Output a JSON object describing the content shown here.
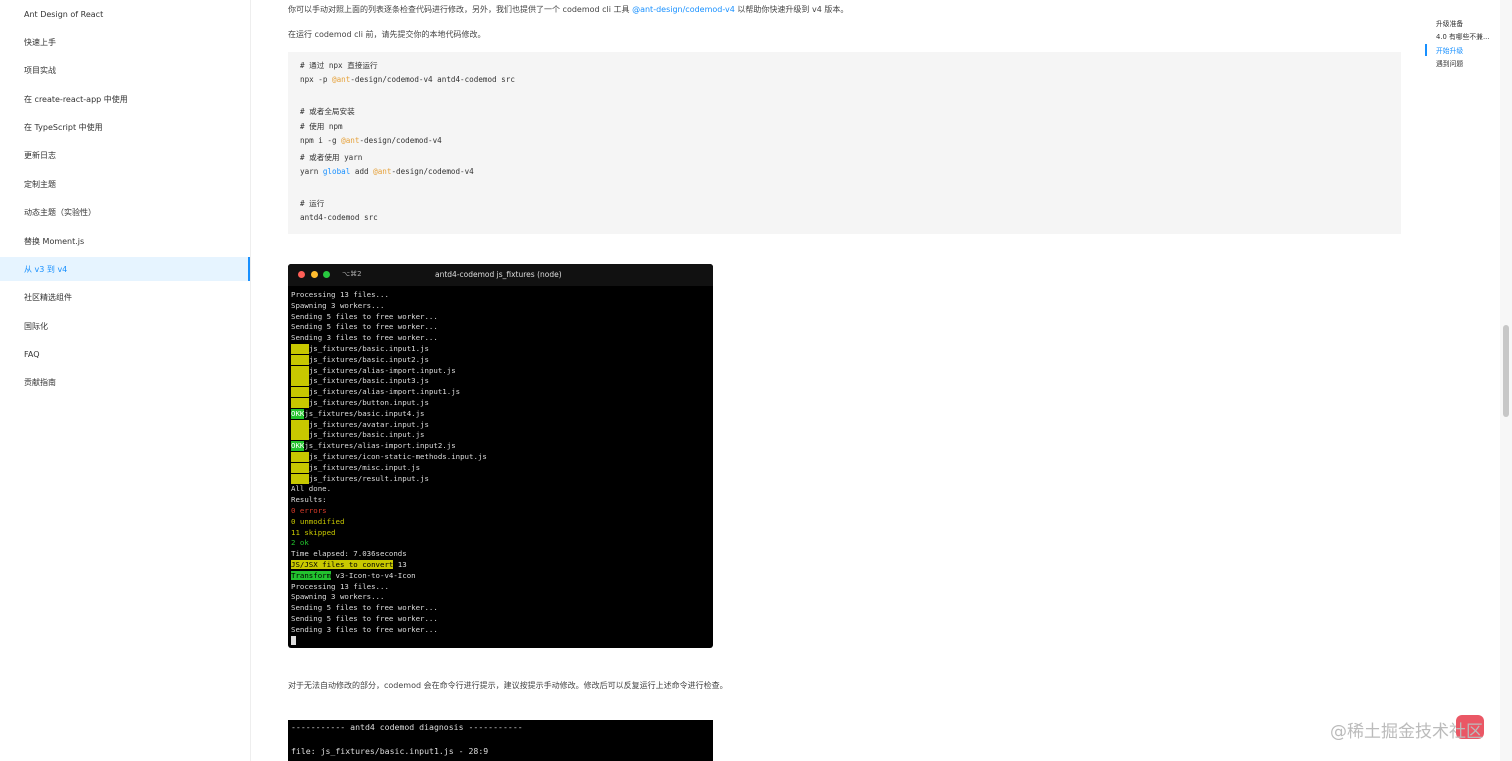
{
  "sidebar": {
    "items": [
      {
        "label": "Ant Design of React"
      },
      {
        "label": "快速上手"
      },
      {
        "label": "项目实战"
      },
      {
        "label": "在 create-react-app 中使用"
      },
      {
        "label": "在 TypeScript 中使用"
      },
      {
        "label": "更新日志"
      },
      {
        "label": "定制主题"
      },
      {
        "label": "动态主题（实验性）"
      },
      {
        "label": "替换 Moment.js"
      },
      {
        "label": "从 v3 到 v4"
      },
      {
        "label": "社区精选组件"
      },
      {
        "label": "国际化"
      },
      {
        "label": "FAQ"
      },
      {
        "label": "贡献指南"
      }
    ],
    "active_index": 9
  },
  "main": {
    "para1_before": "你可以手动对照上面的列表逐条检查代码进行修改，另外，我们也提供了一个 codemod cli 工具 ",
    "para1_link": "@ant-design/codemod-v4",
    "para1_after": " 以帮助你快速升级到 v4 版本。",
    "para2": "在运行 codemod cli 前，请先提交你的本地代码修改。",
    "code": {
      "l1": "# 通过 npx 直接运行",
      "l2_a": "npx -p ",
      "l2_at": "@ant",
      "l2_b": "-design/codemod-v4 antd4-codemod src",
      "l3": "# 或者全局安装",
      "l4": "# 使用 npm",
      "l5_a": "npm i -g ",
      "l5_at": "@ant",
      "l5_b": "-design/codemod-v4",
      "l6": "# 或者使用 yarn",
      "l7_a": "yarn ",
      "l7_kw": "global",
      "l7_b": " add ",
      "l7_at": "@ant",
      "l7_c": "-design/codemod-v4",
      "l8": "# 运行",
      "l9": "antd4-codemod src"
    },
    "para3": "对于无法自动修改的部分，codemod 会在命令行进行提示，建议按提示手动修改。修改后可以反复运行上述命令进行检查。"
  },
  "terminal": {
    "shortcut": "⌥⌘2",
    "title": "antd4-codemod js_fixtures (node)",
    "lines_top": [
      "Processing 13 files...",
      "Spawning 3 workers...",
      "Sending 5 files to free worker...",
      "Sending 5 files to free worker...",
      "Sending 3 files to free worker..."
    ],
    "file_results": [
      {
        "status": "skip",
        "badge": "SKIP",
        "file": "js_fixtures/basic.input1.js"
      },
      {
        "status": "skip",
        "badge": "SKIP",
        "file": "js_fixtures/basic.input2.js"
      },
      {
        "status": "skip",
        "badge": "SKIP",
        "file": "js_fixtures/alias-import.input.js"
      },
      {
        "status": "skip",
        "badge": "SKIP",
        "file": "js_fixtures/basic.input3.js"
      },
      {
        "status": "skip",
        "badge": "SKIP",
        "file": "js_fixtures/alias-import.input1.js"
      },
      {
        "status": "skip",
        "badge": "SKIP",
        "file": "js_fixtures/button.input.js"
      },
      {
        "status": "ok",
        "badge": "OKK",
        "file": "js_fixtures/basic.input4.js"
      },
      {
        "status": "skip",
        "badge": "SKIP",
        "file": "js_fixtures/avatar.input.js"
      },
      {
        "status": "skip",
        "badge": "SKIP",
        "file": "js_fixtures/basic.input.js"
      },
      {
        "status": "ok",
        "badge": "OKK",
        "file": "js_fixtures/alias-import.input2.js"
      },
      {
        "status": "skip",
        "badge": "SKIP",
        "file": "js_fixtures/icon-static-methods.input.js"
      },
      {
        "status": "skip",
        "badge": "SKIP",
        "file": "js_fixtures/misc.input.js"
      },
      {
        "status": "skip",
        "badge": "SKIP",
        "file": "js_fixtures/result.input.js"
      }
    ],
    "all_done": "All done.",
    "results": "Results:",
    "errors": "0 errors",
    "unmodified": "0 unmodified",
    "skipped": "11 skipped",
    "ok": "2 ok",
    "elapsed": "Time elapsed: 7.036seconds",
    "convert_label": "JS/JSX files to convert",
    "convert_count": " 13",
    "transform_label": "Transform",
    "transform_value": " v3-Icon-to-v4-Icon",
    "lines_bottom": [
      "Processing 13 files...",
      "Spawning 3 workers...",
      "Sending 5 files to free worker...",
      "Sending 5 files to free worker...",
      "Sending 3 files to free worker..."
    ]
  },
  "terminal2": {
    "l1": "----------- antd4 codemod diagnosis -----------",
    "l2": "file: js_fixtures/basic.input1.js - 28:9"
  },
  "toc": {
    "items": [
      {
        "label": "升级准备"
      },
      {
        "label": "4.0 有哪些不兼..."
      },
      {
        "label": "开始升级"
      },
      {
        "label": "遇到问题"
      }
    ],
    "active_index": 2
  },
  "watermark": "@稀土掘金技术社区",
  "colors": {
    "accent": "#1890ff",
    "skip_badge": "#c8c800",
    "ok_badge": "#22c32e",
    "error": "#d83a2a"
  }
}
